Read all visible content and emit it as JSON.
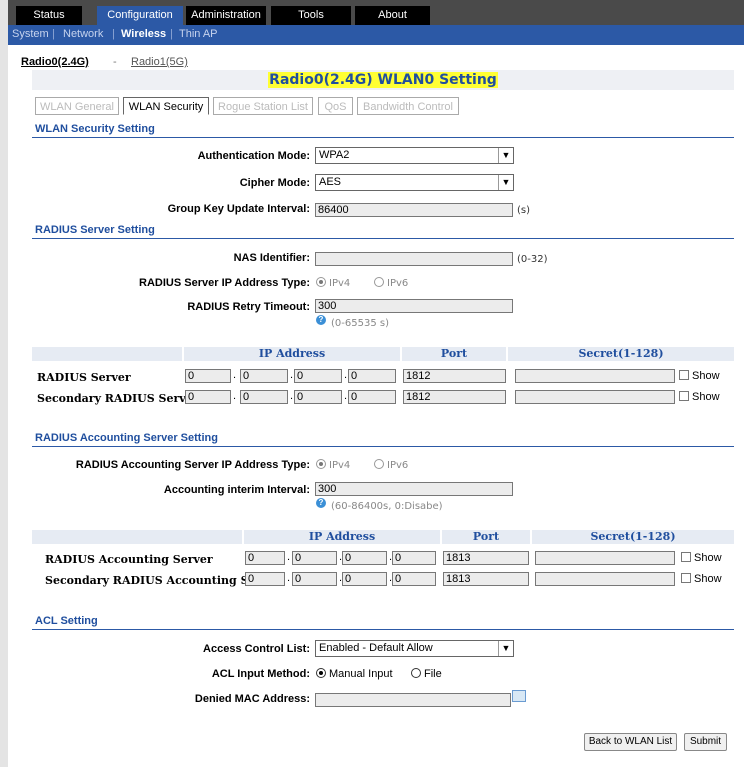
{
  "nav": {
    "tabs": [
      "Status",
      "Configuration",
      "Administration",
      "Tools",
      "About"
    ],
    "sub_items": [
      "System",
      "Network",
      "Wireless",
      "Thin AP"
    ]
  },
  "radio_links": [
    "Radio0(2.4G)",
    "Radio1(5G)"
  ],
  "radio_sep": "-",
  "page_title": "Radio0(2.4G) WLAN0 Setting",
  "subtabs": [
    "WLAN General",
    "WLAN Security",
    "Rogue Station List",
    "QoS",
    "Bandwidth Control"
  ],
  "security": {
    "section_title": "WLAN Security Setting",
    "auth_label": "Authentication Mode:",
    "auth_value": "WPA2",
    "cipher_label": "Cipher Mode:",
    "cipher_value": "AES",
    "gk_label": "Group Key Update Interval:",
    "gk_value": "86400",
    "gk_unit": "(s)"
  },
  "radius": {
    "section_title": "RADIUS Server Setting",
    "nas_label": "NAS Identifier:",
    "nas_value": "",
    "nas_hint": "(0-32)",
    "ip_type_label": "RADIUS Server IP Address Type:",
    "ipv4": "IPv4",
    "ipv6": "IPv6",
    "retry_label": "RADIUS Retry Timeout:",
    "retry_value": "300",
    "retry_hint": "(0-65535 s)",
    "headers": {
      "ip": "IP Address",
      "port": "Port",
      "secret": "Secret(1-128)"
    },
    "rows": [
      {
        "label": "RADIUS Server",
        "ip": [
          "0",
          "0",
          "0",
          "0"
        ],
        "port": "1812",
        "secret": "",
        "show": "Show"
      },
      {
        "label": "Secondary RADIUS Server",
        "ip": [
          "0",
          "0",
          "0",
          "0"
        ],
        "port": "1812",
        "secret": "",
        "show": "Show"
      }
    ]
  },
  "accounting": {
    "section_title": "RADIUS Accounting Server Setting",
    "ip_type_label": "RADIUS Accounting Server IP Address Type:",
    "ipv4": "IPv4",
    "ipv6": "IPv6",
    "interim_label": "Accounting interim Interval:",
    "interim_value": "300",
    "interim_hint": "(60-86400s, 0:Disabe)",
    "headers": {
      "ip": "IP Address",
      "port": "Port",
      "secret": "Secret(1-128)"
    },
    "rows": [
      {
        "label": "RADIUS Accounting Server",
        "ip": [
          "0",
          "0",
          "0",
          "0"
        ],
        "port": "1813",
        "secret": "",
        "show": "Show"
      },
      {
        "label": "Secondary RADIUS Accounting Server",
        "ip": [
          "0",
          "0",
          "0",
          "0"
        ],
        "port": "1813",
        "secret": "",
        "show": "Show"
      }
    ]
  },
  "acl": {
    "section_title": "ACL Setting",
    "list_label": "Access Control List:",
    "list_value": "Enabled - Default Allow",
    "method_label": "ACL Input Method:",
    "method_manual": "Manual Input",
    "method_file": "File",
    "denied_label": "Denied MAC Address:",
    "denied_value": ""
  },
  "buttons": {
    "back": "Back to WLAN List",
    "submit": "Submit"
  },
  "dot": "."
}
